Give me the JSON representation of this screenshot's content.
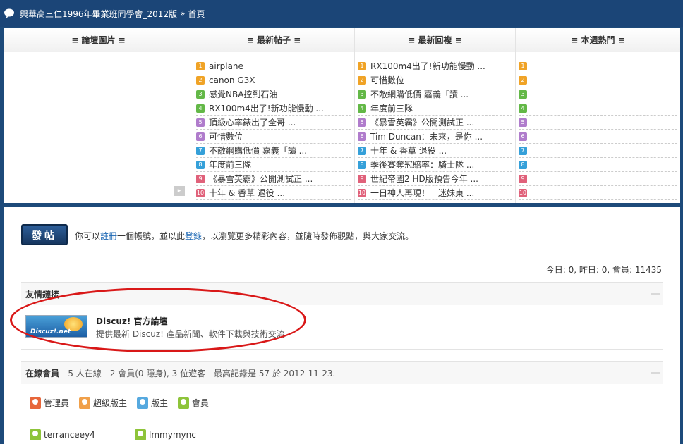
{
  "breadcrumb": {
    "site": "興華高三仁1996年畢業班同學會_2012版",
    "separator": "»",
    "current": "首頁"
  },
  "portal": {
    "headers": [
      "≡ 論壇圖片 ≡",
      "≡ 最新帖子 ≡",
      "≡ 最新回複 ≡",
      "≡ 本週熱門 ≡"
    ],
    "latest_posts": [
      "airplane",
      "canon G3X",
      "感覺NBA控到石油",
      "RX100m4出了!新功能慢動 ...",
      "頂級心率錶出了全哥 ...",
      "可惜數位",
      "不敵網購低價 嘉義「讀 ...",
      "年度前三隊",
      "《暴雪英霸》公開測試正 ...",
      "十年 & 香草 退役 ..."
    ],
    "latest_replies": [
      "RX100m4出了!新功能慢動 ...",
      "可惜數位",
      "不敵網購低價 嘉義「讀 ...",
      "年度前三隊",
      "《暴雪英霸》公開測試正 ...",
      "Tim Duncan：未來，是你 ...",
      "十年 & 香草 退役 ...",
      "季後賽奪冠賠率：騎士隊 ...",
      "世紀帝國2 HD版預告今年 ...",
      "一日神人再現！　迷妹東 ..."
    ],
    "ranks": [
      "1",
      "2",
      "3",
      "4",
      "5",
      "6",
      "7",
      "8",
      "9",
      "10"
    ]
  },
  "post_button": "發帖",
  "register_tip": {
    "pre": "你可以",
    "register": "註冊",
    "mid": "一個帳號，並以此",
    "login": "登錄",
    "post": "，以瀏覽更多精彩內容，並隨時發佈觀點，與大家交流。"
  },
  "stats": "今日: 0, 昨日: 0, 會員: 11435",
  "links": {
    "title": "友情鏈接",
    "collapse": "—",
    "logo_label": "Discuz!.net",
    "site_name": "Discuz! 官方論壇",
    "site_desc": "提供最新 Discuz! 產品新聞、軟件下載與技術交流"
  },
  "online": {
    "title": "在線會員",
    "summary": "- 5 人在線 - 2 會員(0 隱身), 3 位遊客 - 最高記錄是 57 於 2012-11-23.",
    "collapse": "—",
    "legend": [
      "管理員",
      "超級版主",
      "版主",
      "會員"
    ],
    "members": [
      "terranceey4",
      "Immymync"
    ]
  },
  "colors": {
    "topbar": "#1b4577",
    "background": "#1d4a7a",
    "annotation": "#d91818"
  }
}
